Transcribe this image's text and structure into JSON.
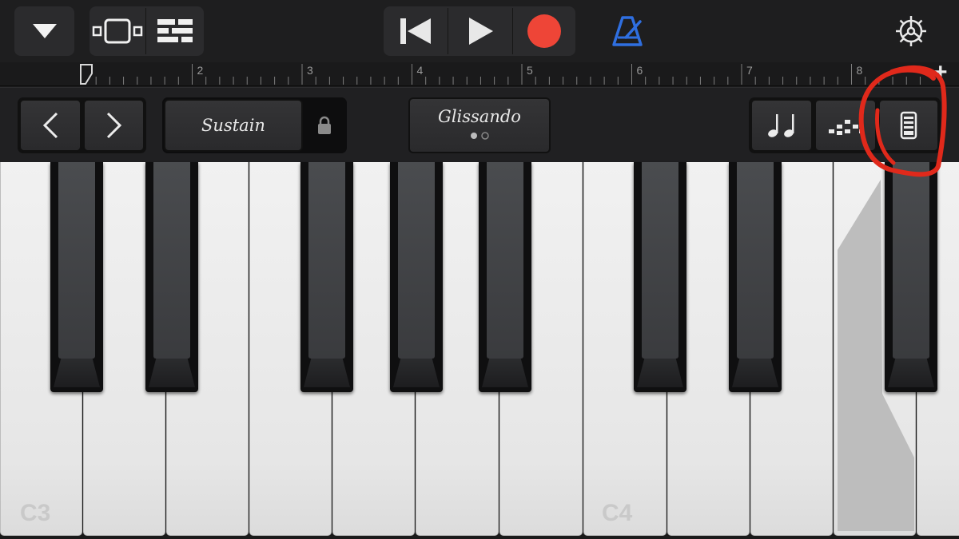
{
  "toolbar": {
    "browser_button": "browser-dropdown",
    "view_buttons": [
      "instrument-view",
      "tracks-view"
    ],
    "transport": [
      "go-to-beginning",
      "play",
      "record"
    ],
    "metronome": "metronome",
    "settings": "settings",
    "colors": {
      "record": "#ee4537",
      "metronome": "#2f6fe0"
    }
  },
  "ruler": {
    "bars": [
      "2",
      "3",
      "4",
      "5",
      "6",
      "7",
      "8"
    ],
    "add_label": "+"
  },
  "controls": {
    "octave_down": "octave-down",
    "octave_up": "octave-up",
    "sustain_label": "Sustain",
    "glissando_label": "Glissando",
    "right_buttons": [
      "notes-mode",
      "arpeggiator",
      "keyboard-controls"
    ]
  },
  "keyboard": {
    "labels": {
      "c3": "C3",
      "c4": "C4"
    },
    "highlight_color": "#bdbdbd"
  },
  "annotation": {
    "color": "#e0291b"
  }
}
